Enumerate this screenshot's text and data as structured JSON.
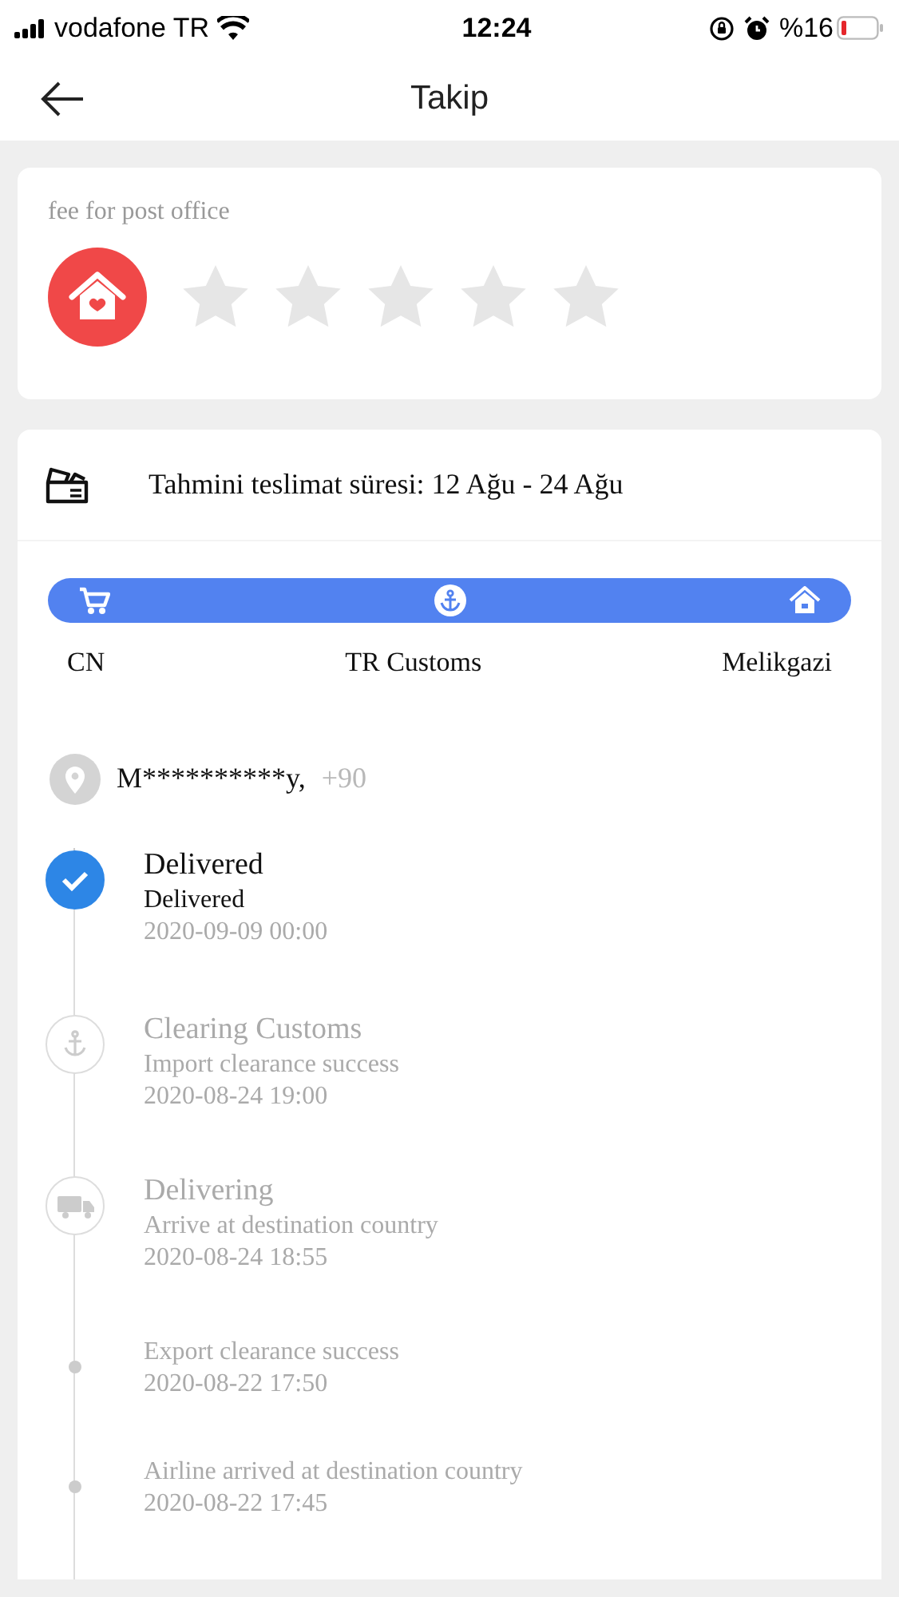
{
  "status_bar": {
    "carrier": "vodafone TR",
    "time": "12:24",
    "battery": "%16"
  },
  "header": {
    "title": "Takip"
  },
  "rating": {
    "label": "fee for post office",
    "stars": 0
  },
  "delivery": {
    "estimate": "Tahmini teslimat süresi: 12 Ağu - 24 Ağu",
    "route": [
      {
        "label": "CN"
      },
      {
        "label": "TR Customs"
      },
      {
        "label": "Melikgazi"
      }
    ]
  },
  "address": {
    "name": "M**********y,",
    "phone": "+90"
  },
  "events": [
    {
      "kind": "delivered",
      "active": true,
      "title": "Delivered",
      "detail": "Delivered",
      "time": "2020-09-09 00:00"
    },
    {
      "kind": "customs",
      "active": false,
      "title": "Clearing Customs",
      "detail": "Import clearance success",
      "time": "2020-08-24 19:00"
    },
    {
      "kind": "delivering",
      "active": false,
      "title": "Delivering",
      "detail": "Arrive at destination country",
      "time": "2020-08-24 18:55"
    },
    {
      "kind": "minor",
      "active": false,
      "detail": "Export clearance success",
      "time": "2020-08-22 17:50"
    },
    {
      "kind": "minor",
      "active": false,
      "detail": "Airline arrived at destination country",
      "time": "2020-08-22 17:45"
    }
  ]
}
